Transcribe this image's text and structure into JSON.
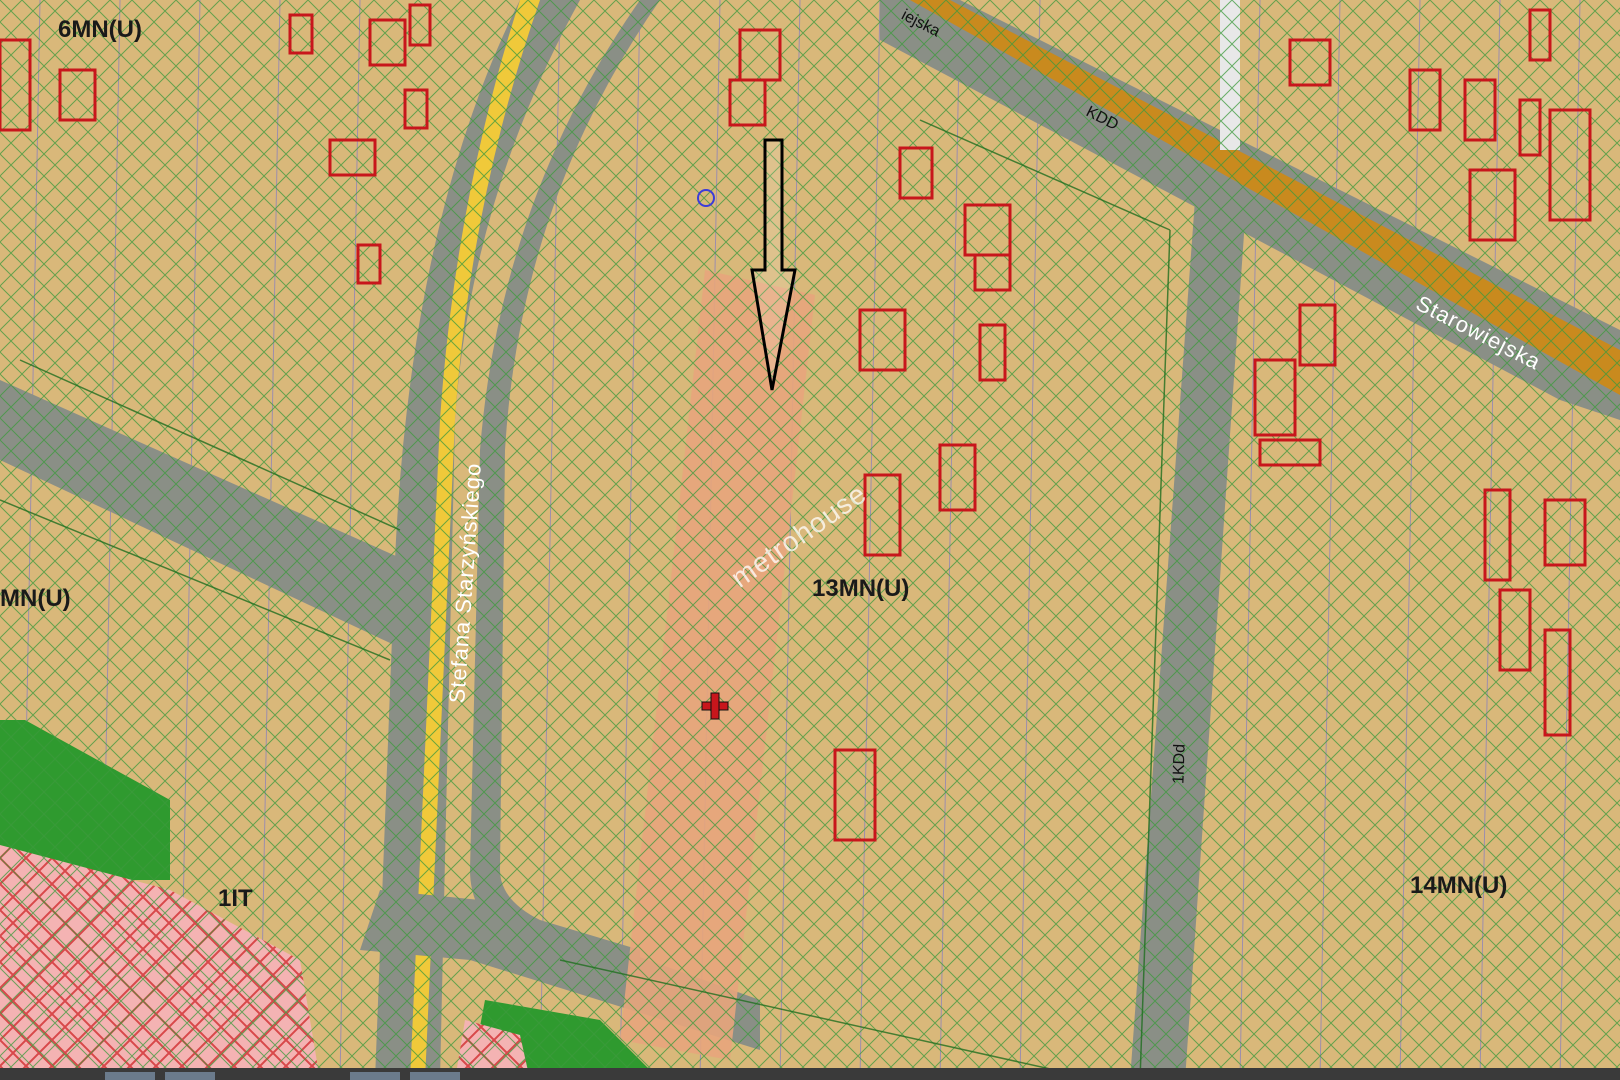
{
  "map": {
    "colors": {
      "residential": "#d9b87a",
      "hatch": "#3c9a3c",
      "grid": "#6c6cd8",
      "road": "#8a8f86",
      "arterial": "#c98a1e",
      "highlight": "#e7a57c",
      "green": "#2f9a2f",
      "pink": "#f2a6a6",
      "building": "#c8161c"
    },
    "zones": [
      {
        "id": "z-6mnu",
        "label": "6MN(U)"
      },
      {
        "id": "z-mnu-left",
        "label": "MN(U)"
      },
      {
        "id": "z-13mnu",
        "label": "13MN(U)"
      },
      {
        "id": "z-14mnu",
        "label": "14MN(U)"
      },
      {
        "id": "z-1it",
        "label": "1IT"
      }
    ],
    "streets": [
      {
        "id": "s-starzynskiego",
        "label": "Stefana Starzyńskiego"
      },
      {
        "id": "s-starowiejska",
        "label": "Starowiejska"
      },
      {
        "id": "s-starowiejska-top",
        "label": "iejska"
      },
      {
        "id": "s-kdd",
        "label": "KDD"
      },
      {
        "id": "s-kdd2",
        "label": "1KDd"
      }
    ],
    "watermark": "metrohouse",
    "icons": [
      "arrow-down-icon",
      "plus-marker-icon",
      "circle-symbol-icon"
    ]
  }
}
